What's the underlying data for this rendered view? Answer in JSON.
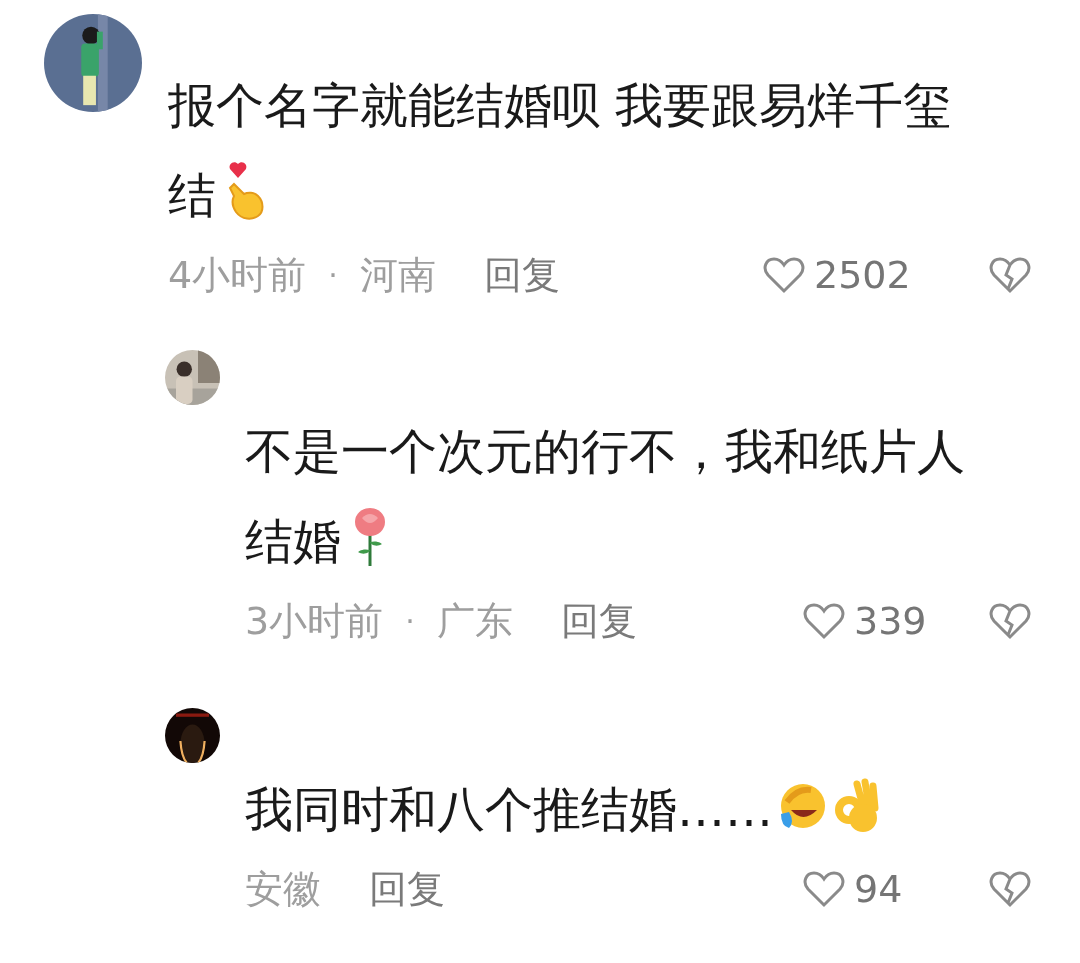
{
  "comments": [
    {
      "kind": "comment",
      "avatar": {
        "kind": "picture"
      },
      "lines": [
        "报个名字就能结婚呗 我要跟易烊千玺",
        "结"
      ],
      "emojis": [
        {
          "kind": "finger-heart"
        }
      ],
      "time": "4小时前",
      "separator": "·",
      "location": "河南",
      "reply": "回复",
      "likes": "2502"
    },
    {
      "kind": "reply",
      "avatar": {
        "kind": "picture"
      },
      "lines": [
        "不是一个次元的行不，我和纸片人",
        "结婚"
      ],
      "emojis": [
        {
          "kind": "rose"
        }
      ],
      "time": "3小时前",
      "separator": "·",
      "location": "广东",
      "reply": "回复",
      "likes": "339"
    },
    {
      "kind": "reply",
      "avatar": {
        "kind": "picture"
      },
      "lines": [
        "我同时和八个推结婚……"
      ],
      "emojis": [
        {
          "kind": "laugh-cry"
        },
        {
          "kind": "ok-hand"
        }
      ],
      "location": "安徽",
      "reply": "回复",
      "likes": "94"
    }
  ]
}
